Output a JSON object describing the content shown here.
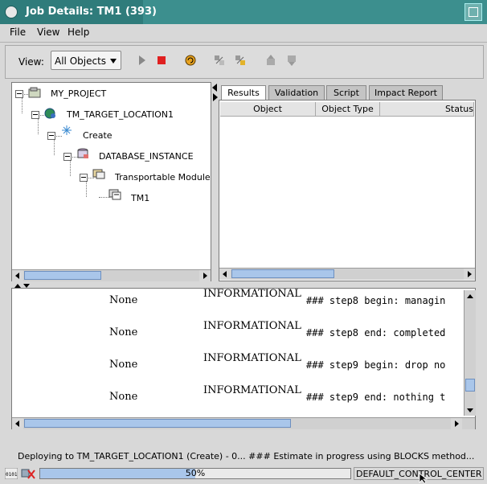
{
  "window": {
    "title": "Job Details: TM1  (393)"
  },
  "menu": {
    "items": [
      "File",
      "View",
      "Help"
    ]
  },
  "toolbar": {
    "view_label": "View:",
    "view_value": "All Objects",
    "icons": [
      "run-icon",
      "stop-icon",
      "refresh-icon",
      "expand-icon",
      "collapse-icon",
      "move-up-icon",
      "move-down-icon"
    ]
  },
  "tree": {
    "nodes": [
      "MY_PROJECT",
      "TM_TARGET_LOCATION1",
      "Create",
      "DATABASE_INSTANCE",
      "Transportable Module",
      "TM1"
    ]
  },
  "tabs": [
    "Results",
    "Validation",
    "Script",
    "Impact Report"
  ],
  "results": {
    "columns": [
      "Object",
      "Object Type",
      "Status"
    ]
  },
  "log": {
    "rows": [
      {
        "none": "None",
        "severity": "INFORMATIONAL",
        "message": "### step8 begin: managin"
      },
      {
        "none": "None",
        "severity": "INFORMATIONAL",
        "message": "### step8 end: completed"
      },
      {
        "none": "None",
        "severity": "INFORMATIONAL",
        "message": "### step9 begin: drop no"
      },
      {
        "none": "None",
        "severity": "INFORMATIONAL",
        "message": "### step9 end: nothing t"
      }
    ]
  },
  "status": {
    "text": "Deploying  to TM_TARGET_LOCATION1 (Create) - 0... ### Estimate in progress using BLOCKS method...",
    "progress_text": "50%",
    "progress": 0.5,
    "control_center": "DEFAULT_CONTROL_CENTER"
  },
  "colors": {
    "title_bar": "#3c8f8e",
    "scroll_thumb": "#a9c6ea",
    "stop_red": "#e02020"
  }
}
